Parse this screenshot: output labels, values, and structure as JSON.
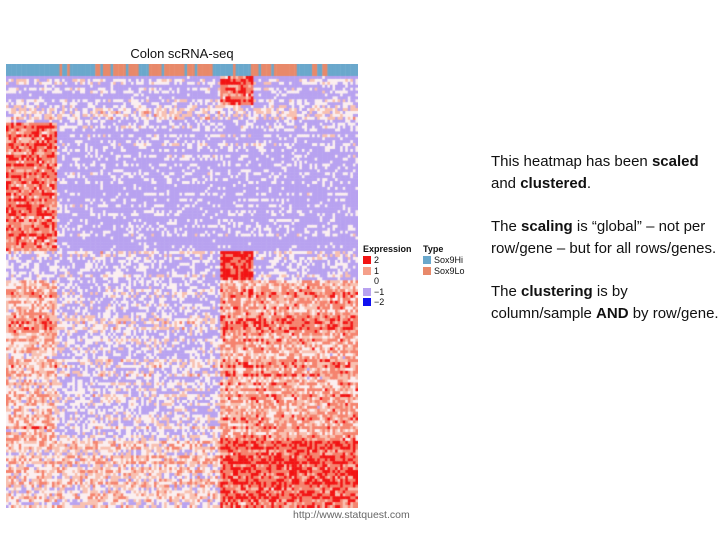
{
  "chart_data": {
    "type": "heatmap",
    "title": "Colon scRNA-seq",
    "color_scale": [
      {
        "value": 2,
        "label": "2",
        "color": "#f21414"
      },
      {
        "value": 1,
        "label": "1",
        "color": "#f5a08a"
      },
      {
        "value": 0,
        "label": "0",
        "color": "#ffffff"
      },
      {
        "value": -1,
        "label": "−1",
        "color": "#b8a2f0"
      },
      {
        "value": -2,
        "label": "−2",
        "color": "#1010f0"
      }
    ],
    "legend_expression_title": "Expression",
    "legend_type_title": "Type",
    "types": [
      {
        "label": "Sox9Hi",
        "color": "#6aa8cc"
      },
      {
        "label": "Sox9Lo",
        "color": "#e8896a"
      }
    ],
    "column_type_runs": [
      [
        0,
        21
      ],
      [
        1,
        1
      ],
      [
        0,
        2
      ],
      [
        1,
        1
      ],
      [
        0,
        10
      ],
      [
        1,
        2
      ],
      [
        0,
        1
      ],
      [
        1,
        3
      ],
      [
        0,
        1
      ],
      [
        1,
        5
      ],
      [
        0,
        1
      ],
      [
        1,
        4
      ],
      [
        0,
        4
      ],
      [
        1,
        5
      ],
      [
        0,
        1
      ],
      [
        1,
        8
      ],
      [
        0,
        1
      ],
      [
        1,
        3
      ],
      [
        0,
        1
      ],
      [
        1,
        6
      ],
      [
        0,
        8
      ],
      [
        1,
        1
      ],
      [
        0,
        6
      ],
      [
        1,
        3
      ],
      [
        0,
        1
      ],
      [
        1,
        4
      ],
      [
        0,
        1
      ],
      [
        1,
        9
      ],
      [
        0,
        6
      ],
      [
        1,
        2
      ],
      [
        0,
        2
      ],
      [
        1,
        2
      ],
      [
        0,
        12
      ]
    ],
    "legend_placement": "right",
    "clustered_rows": true,
    "clustered_columns": true
  },
  "notes": {
    "p1": {
      "a": "This heatmap has been ",
      "b": "scaled",
      "c": " and ",
      "d": "clustered",
      "e": "."
    },
    "p2": {
      "a": "The ",
      "b": "scaling",
      "c": " is “global” – not per row/gene – but for all rows/genes."
    },
    "p3": {
      "a": "The ",
      "b": "clustering",
      "c": " is by column/sample ",
      "d": "AND",
      "e": " by row/gene."
    }
  },
  "footer": "http://www.statquest.com"
}
